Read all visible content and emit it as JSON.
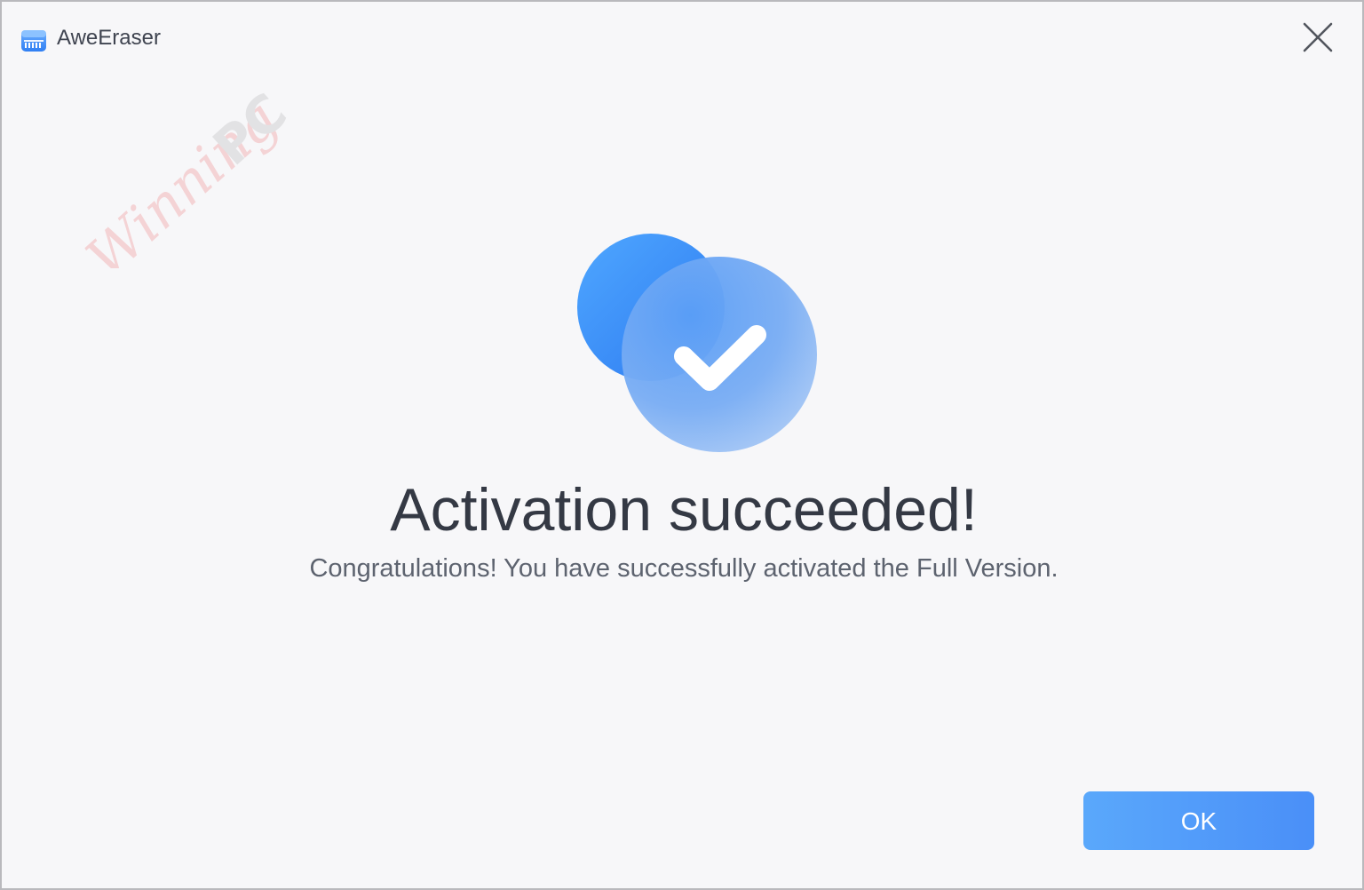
{
  "window": {
    "title": "AweEraser",
    "close_icon": "close-icon",
    "app_icon": "aweeraser-logo-icon"
  },
  "watermark": {
    "text_script": "Winning",
    "text_bold": "PC"
  },
  "dialog": {
    "hero_icon": "success-check-icon",
    "headline": "Activation succeeded!",
    "message": "Congratulations! You have successfully activated the Full Version.",
    "ok_label": "OK"
  },
  "colors": {
    "accent": "#4a8ff8",
    "background": "#f7f7f9",
    "headline": "#343944",
    "message": "#5d636f"
  }
}
